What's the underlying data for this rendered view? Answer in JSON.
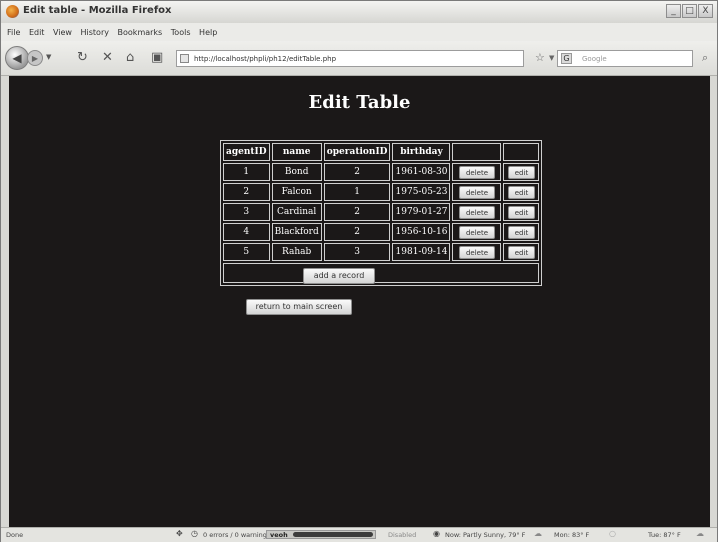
{
  "window": {
    "title": "Edit table - Mozilla Firefox",
    "controls": {
      "minimize": "_",
      "maximize": "□",
      "close": "X"
    }
  },
  "menu": [
    "File",
    "Edit",
    "View",
    "History",
    "Bookmarks",
    "Tools",
    "Help"
  ],
  "nav": {
    "url": "http://localhost/phpli/ph12/editTable.php",
    "search_placeholder": "Google",
    "search_engine_letter": "G"
  },
  "page": {
    "title": "Edit Table",
    "columns": [
      "agentID",
      "name",
      "operationID",
      "birthday",
      "",
      ""
    ],
    "rows": [
      {
        "agentID": "1",
        "name": "Bond",
        "operationID": "2",
        "birthday": "1961-08-30"
      },
      {
        "agentID": "2",
        "name": "Falcon",
        "operationID": "1",
        "birthday": "1975-05-23"
      },
      {
        "agentID": "3",
        "name": "Cardinal",
        "operationID": "2",
        "birthday": "1979-01-27"
      },
      {
        "agentID": "4",
        "name": "Blackford",
        "operationID": "2",
        "birthday": "1956-10-16"
      },
      {
        "agentID": "5",
        "name": "Rahab",
        "operationID": "3",
        "birthday": "1981-09-14"
      }
    ],
    "delete_label": "delete",
    "edit_label": "edit",
    "add_label": "add a record",
    "return_label": "return to main screen"
  },
  "status": {
    "left": "Done",
    "errors": "0 errors / 0 warnings",
    "addon": "veoh",
    "disabled": "Disabled",
    "weather_now": "Now: Partly Sunny, 79° F",
    "weather_mon": "Mon: 83° F",
    "weather_tue": "Tue: 87° F"
  },
  "colors": {
    "page_background": "#1b1818",
    "page_text": "#ffffff",
    "chrome": "#d8d8d4"
  }
}
